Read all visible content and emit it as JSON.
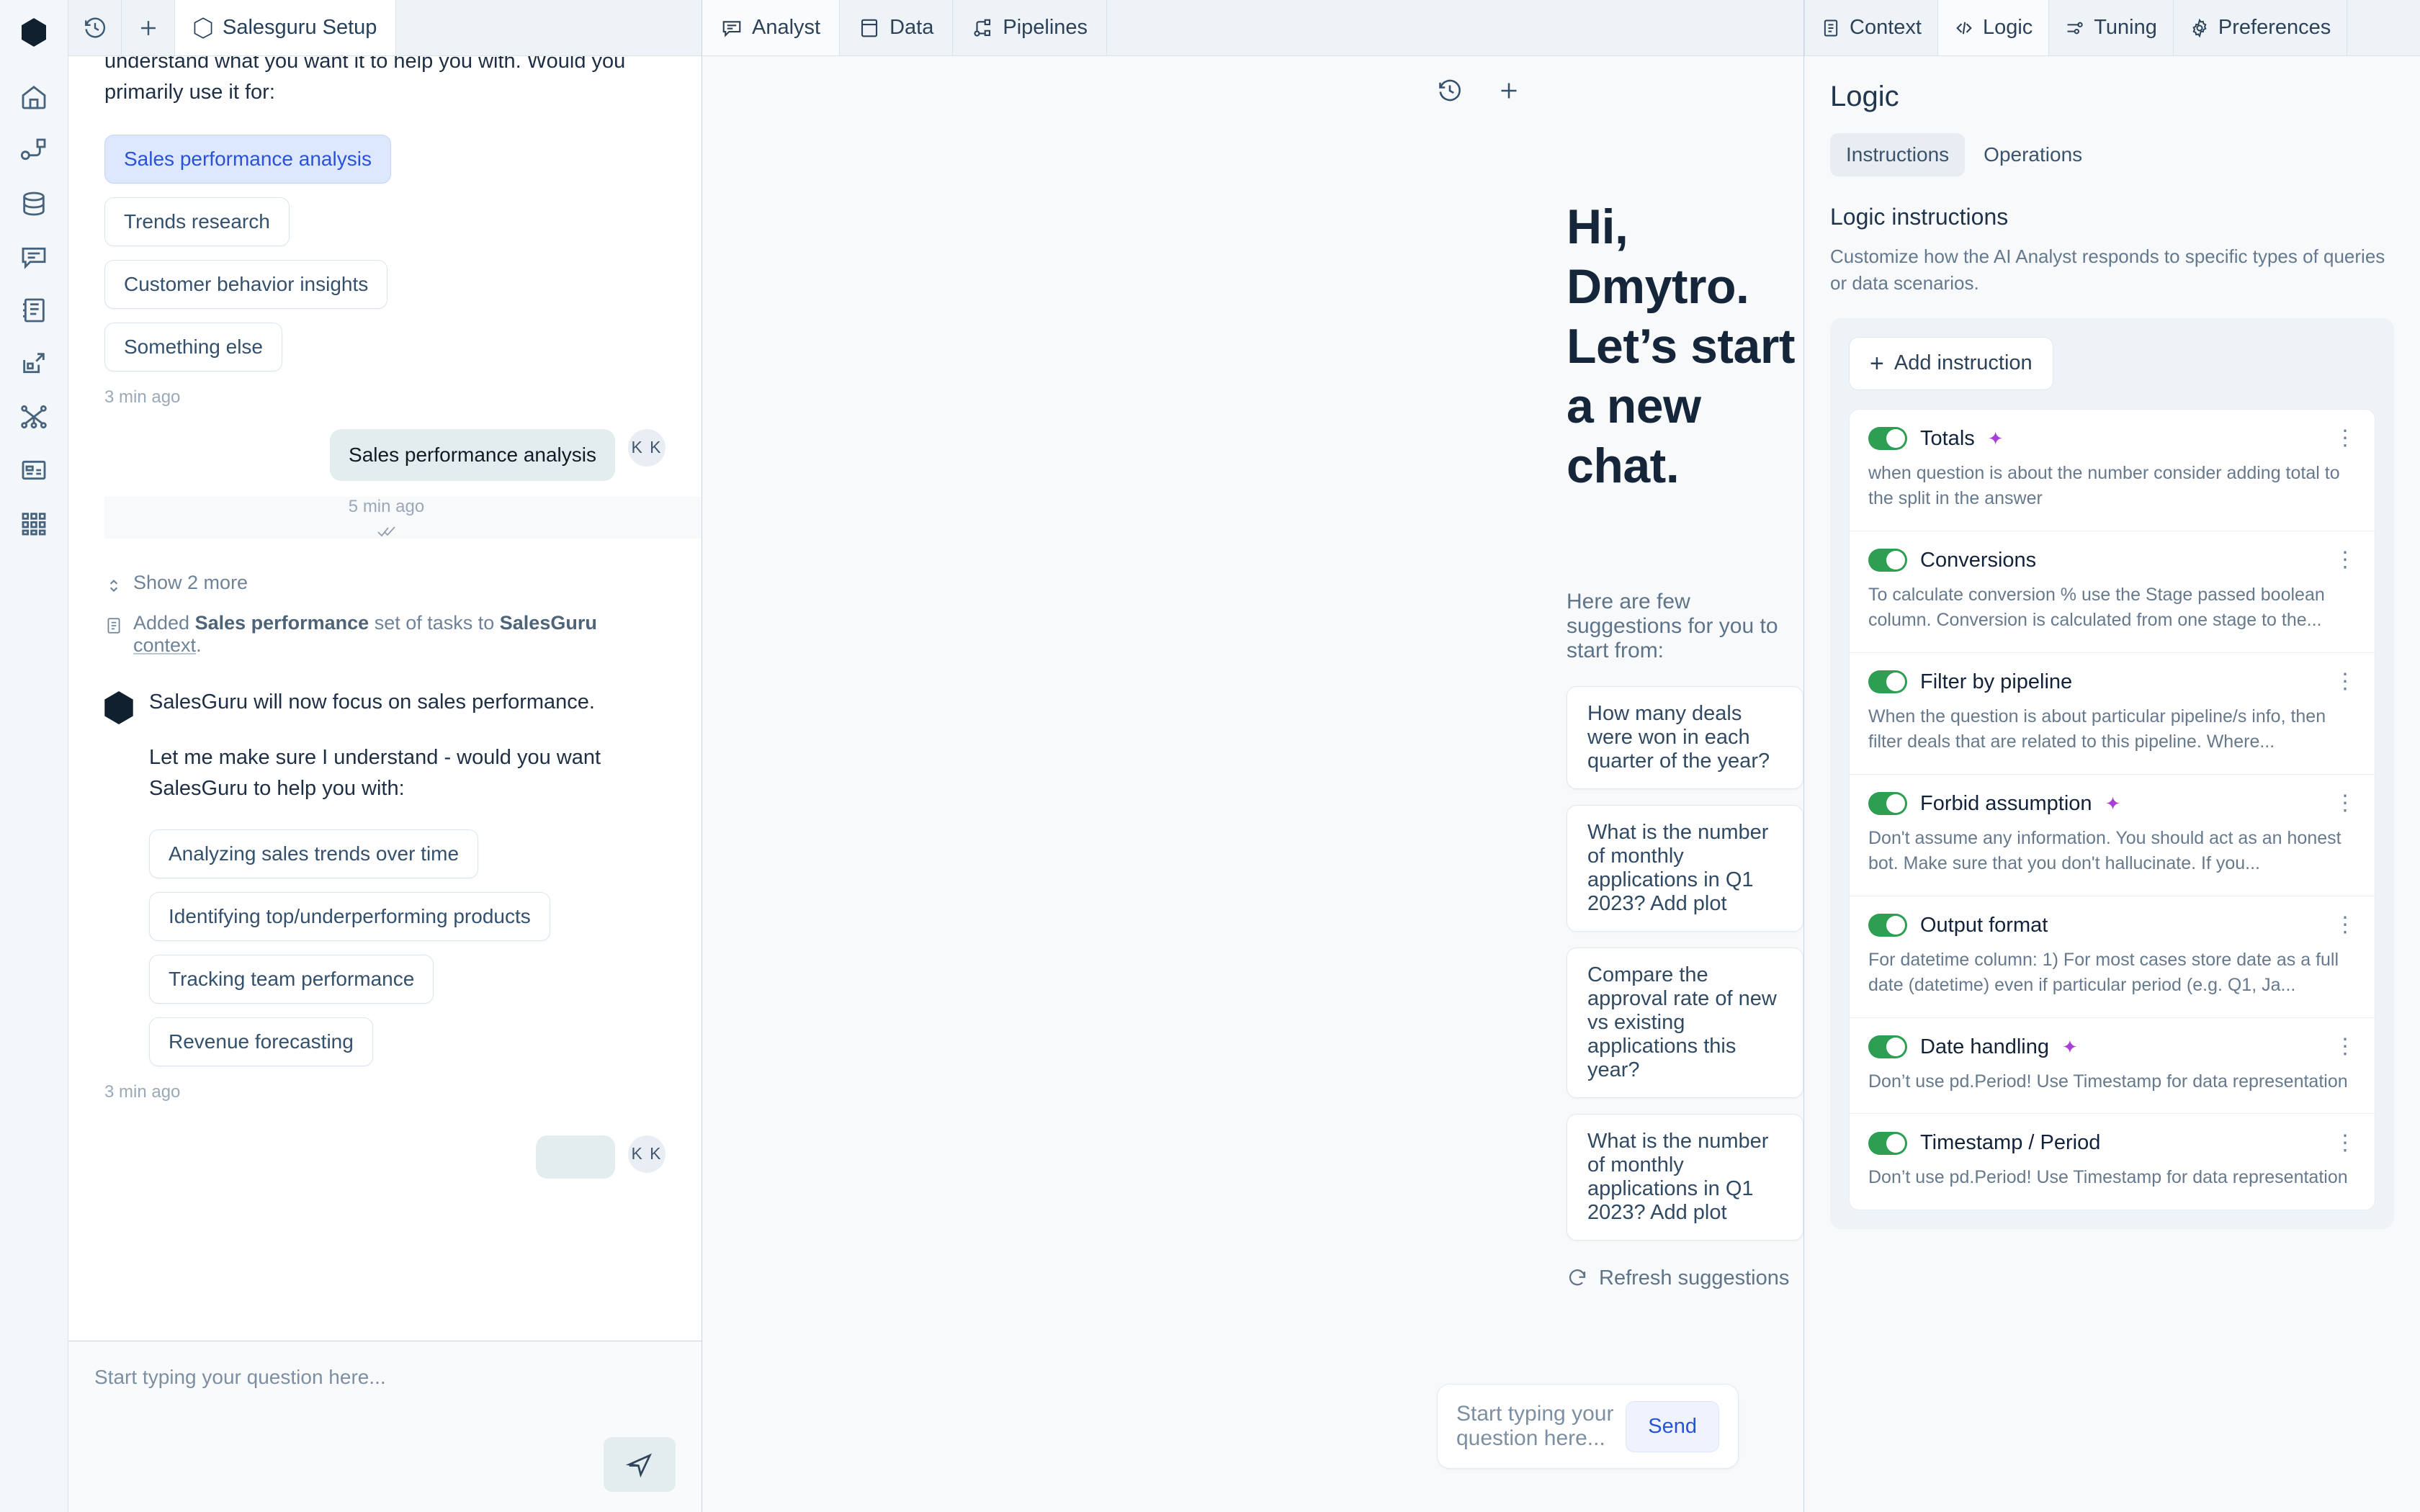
{
  "left_rail": {
    "logo": "hexagon-logo",
    "items": [
      {
        "icon": "home-icon",
        "name": "home"
      },
      {
        "icon": "workflow-icon",
        "name": "workflow"
      },
      {
        "icon": "database-icon",
        "name": "database"
      },
      {
        "icon": "chat-icon",
        "name": "chat"
      },
      {
        "icon": "notebook-icon",
        "name": "notebook"
      },
      {
        "icon": "export-icon",
        "name": "export"
      },
      {
        "icon": "network-icon",
        "name": "network"
      },
      {
        "icon": "card-icon",
        "name": "card"
      },
      {
        "icon": "grid-icon",
        "name": "grid"
      }
    ]
  },
  "chat_panel": {
    "tab_label": "Salesguru Setup",
    "history_icon": "history-icon",
    "new_icon": "plus-icon",
    "messages": {
      "intro_text": "understand what you want it to help you with. Would you primarily use it for:",
      "options_1": [
        {
          "label": "Sales performance analysis",
          "selected": true
        },
        {
          "label": "Trends research",
          "selected": false
        },
        {
          "label": "Customer behavior insights",
          "selected": false
        },
        {
          "label": "Something else",
          "selected": false
        }
      ],
      "timestamp_1": "3 min ago",
      "user_message": "Sales performance analysis",
      "user_initials": "K K",
      "timestamp_2": "5 min ago",
      "show_more": "Show 2 more",
      "system_note_prefix": "Added ",
      "system_note_bold": "Sales performance",
      "system_note_mid": " set of tasks to ",
      "system_note_bold2": "SalesGuru",
      "system_note_link": " context",
      "system_note_end": ".",
      "bot_line_1": "SalesGuru will now focus on sales performance.",
      "bot_line_2": "Let me make sure I understand - would you want SalesGuru to help you with:",
      "options_2": [
        {
          "label": "Analyzing sales trends over time"
        },
        {
          "label": "Identifying top/underperforming products"
        },
        {
          "label": "Tracking team performance"
        },
        {
          "label": "Revenue forecasting"
        }
      ],
      "timestamp_3": "3 min ago"
    },
    "composer_placeholder": "Start typing your question here...",
    "send_icon": "send-icon"
  },
  "center": {
    "tabs": [
      {
        "label": "Analyst",
        "icon": "chat-icon",
        "active": true
      },
      {
        "label": "Data",
        "icon": "table-icon",
        "active": false
      },
      {
        "label": "Pipelines",
        "icon": "pipeline-icon",
        "active": false
      }
    ],
    "toolbar": [
      {
        "icon": "history-icon",
        "name": "history"
      },
      {
        "icon": "plus-icon",
        "name": "new-chat"
      }
    ],
    "greeting_line1": "Hi, Dmytro.",
    "greeting_line2": "Let’s start a new chat.",
    "suggestions_intro": "Here are few suggestions for you to start from:",
    "suggestions": [
      "How many deals were won in each quarter of the year?",
      "What is the number of monthly applications in Q1 2023? Add plot",
      "Compare the approval rate of new vs existing applications this year?",
      "What is the number of monthly applications in Q1 2023? Add plot"
    ],
    "refresh_label": "Refresh suggestions",
    "composer_placeholder": "Start typing your question here...",
    "send_label": "Send"
  },
  "right": {
    "tabs": [
      {
        "label": "Context",
        "icon": "clipboard-icon",
        "active": false
      },
      {
        "label": "Logic",
        "icon": "code-icon",
        "active": true
      },
      {
        "label": "Tuning",
        "icon": "sliders-icon",
        "active": false
      },
      {
        "label": "Preferences",
        "icon": "gear-icon",
        "active": false
      }
    ],
    "title": "Logic",
    "segments": [
      {
        "label": "Instructions",
        "active": true
      },
      {
        "label": "Operations",
        "active": false
      }
    ],
    "section_title": "Logic instructions",
    "section_desc": "Customize how the AI Analyst responds to specific types of queries or data scenarios.",
    "add_label": "Add instruction",
    "instructions": [
      {
        "title": "Totals",
        "enabled": true,
        "ai_badge": true,
        "desc": "when question is about the number consider adding total to the split in the answer"
      },
      {
        "title": "Conversions",
        "enabled": true,
        "ai_badge": false,
        "desc": "To calculate conversion % use the Stage passed boolean column. Conversion is calculated from one stage to the..."
      },
      {
        "title": "Filter by pipeline",
        "enabled": true,
        "ai_badge": false,
        "desc": "When the question is about particular pipeline/s info, then filter deals that are related to this pipeline. Where..."
      },
      {
        "title": "Forbid assumption",
        "enabled": true,
        "ai_badge": true,
        "desc": "Don't assume any information. You should act as an honest bot. Make sure that you don't hallucinate. If you..."
      },
      {
        "title": "Output format",
        "enabled": true,
        "ai_badge": false,
        "desc": "For datetime column: 1) For most cases store date as a full date (datetime) even if particular period (e.g. Q1, Ja..."
      },
      {
        "title": "Date handling",
        "enabled": true,
        "ai_badge": true,
        "desc": "Don’t use pd.Period! Use Timestamp for data representation"
      },
      {
        "title": "Timestamp / Period",
        "enabled": true,
        "ai_badge": false,
        "desc": "Don’t use pd.Period! Use Timestamp for data representation"
      }
    ]
  },
  "colors": {
    "accent_blue": "#2a52d6",
    "toggle_green": "#2e9e52",
    "sparkle_purple": "#a93fd8",
    "text_dark": "#16263a"
  }
}
